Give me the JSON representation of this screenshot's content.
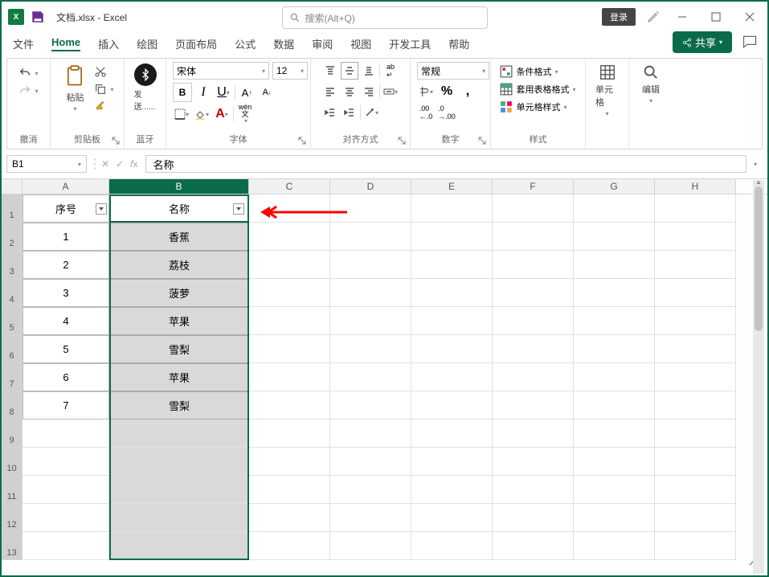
{
  "titlebar": {
    "app_glyph": "X",
    "doc_name": "文档.xlsx  -  Excel",
    "search_placeholder": "搜索(Alt+Q)",
    "login_label": "登录"
  },
  "tabs": {
    "file": "文件",
    "home": "Home",
    "insert": "插入",
    "draw": "绘图",
    "layout": "页面布局",
    "formulas": "公式",
    "data": "数据",
    "review": "审阅",
    "view": "视图",
    "dev": "开发工具",
    "help": "帮助"
  },
  "share_label": "共享",
  "ribbon": {
    "undo_group": "撤消",
    "clipboard_group": "剪贴板",
    "paste_label": "粘贴",
    "bluetooth_group": "蓝牙",
    "send_label": "发送......",
    "font_group": "字体",
    "font_name": "宋体",
    "font_size": "12",
    "align_group": "对齐方式",
    "number_group": "数字",
    "number_format": "常规",
    "styles_group": "样式",
    "cond_format": "条件格式",
    "table_format": "套用表格格式",
    "cell_styles": "单元格样式",
    "cells_group": "单元格",
    "editing_group": "编辑"
  },
  "formula_bar": {
    "name_box": "B1",
    "formula": "名称"
  },
  "columns": [
    "A",
    "B",
    "C",
    "D",
    "E",
    "F",
    "G",
    "H"
  ],
  "row_numbers": [
    "1",
    "2",
    "3",
    "4",
    "5",
    "6",
    "7",
    "8",
    "9",
    "10",
    "11",
    "12",
    "13"
  ],
  "data": {
    "header_a": "序号",
    "header_b": "名称",
    "rows": [
      {
        "a": "1",
        "b": "香蕉"
      },
      {
        "a": "2",
        "b": "荔枝"
      },
      {
        "a": "3",
        "b": "菠萝"
      },
      {
        "a": "4",
        "b": "苹果"
      },
      {
        "a": "5",
        "b": "雪梨"
      },
      {
        "a": "6",
        "b": "苹果"
      },
      {
        "a": "7",
        "b": "雪梨"
      }
    ]
  },
  "active_cell_value": "名称"
}
